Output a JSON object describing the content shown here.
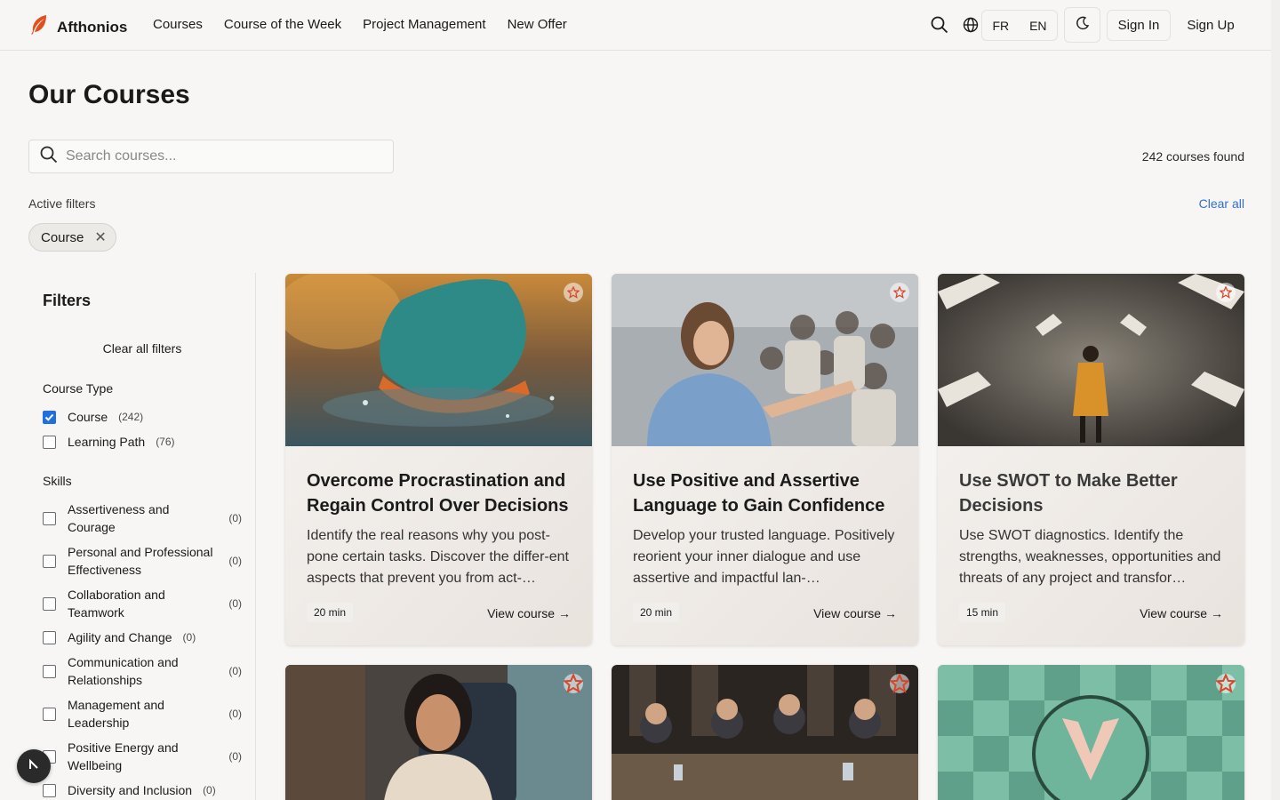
{
  "brand": {
    "name": "Afthonios"
  },
  "nav": [
    "Courses",
    "Course of the Week",
    "Project Management",
    "New Offer"
  ],
  "header": {
    "lang_fr": "FR",
    "lang_en": "EN",
    "sign_in": "Sign In",
    "sign_up": "Sign Up"
  },
  "page_title": "Our Courses",
  "search": {
    "placeholder": "Search courses..."
  },
  "results_count": "242 courses found",
  "active_filters": {
    "label": "Active filters",
    "clear_all": "Clear all",
    "chips": [
      "Course"
    ]
  },
  "filters": {
    "title": "Filters",
    "clear_all": "Clear all filters",
    "course_type": {
      "title": "Course Type",
      "options": [
        {
          "label": "Course",
          "count": "(242)",
          "checked": true
        },
        {
          "label": "Learning Path",
          "count": "(76)",
          "checked": false
        }
      ]
    },
    "skills": {
      "title": "Skills",
      "options": [
        {
          "label": "Assertiveness and Courage",
          "count": "(0)"
        },
        {
          "label": "Personal and Professional Effectiveness",
          "count": "(0)"
        },
        {
          "label": "Collaboration and Teamwork",
          "count": "(0)"
        },
        {
          "label": "Agility and Change",
          "count": "(0)"
        },
        {
          "label": "Communication and Relationships",
          "count": "(0)"
        },
        {
          "label": "Management and Leadership",
          "count": "(0)"
        },
        {
          "label": "Positive Energy and Wellbeing",
          "count": "(0)"
        },
        {
          "label": "Diversity and Inclusion",
          "count": "(0)"
        }
      ]
    }
  },
  "courses": [
    {
      "title": "Overcome Procrastination and Regain Control Over Decisions",
      "description": "Identify the real reasons why you post-pone certain tasks. Discover the differ-ent aspects that prevent you from act-…",
      "duration": "20 min",
      "cta": "View course →"
    },
    {
      "title": "Use Positive and Assertive Language to Gain Confidence",
      "description": "Develop your trusted language. Positively reorient your inner dialogue and use assertive and impactful lan-…",
      "duration": "20 min",
      "cta": "View course →"
    },
    {
      "title": "Use SWOT to Make Better Decisions",
      "description": "Use SWOT diagnostics. Identify the strengths, weaknesses, opportunities and threats of any project and transfor…",
      "duration": "15 min",
      "cta": "View course →"
    }
  ],
  "colors": {
    "accent": "#1f6fe0",
    "link": "#2f6fd0",
    "logo": "#e0501f",
    "favorite": "#d9472b"
  },
  "icons": {
    "search": "search-icon",
    "globe": "globe-icon",
    "theme": "moon-icon",
    "favorite": "star-icon",
    "close": "close-icon",
    "scroll_top": "arrow-up-icon"
  }
}
